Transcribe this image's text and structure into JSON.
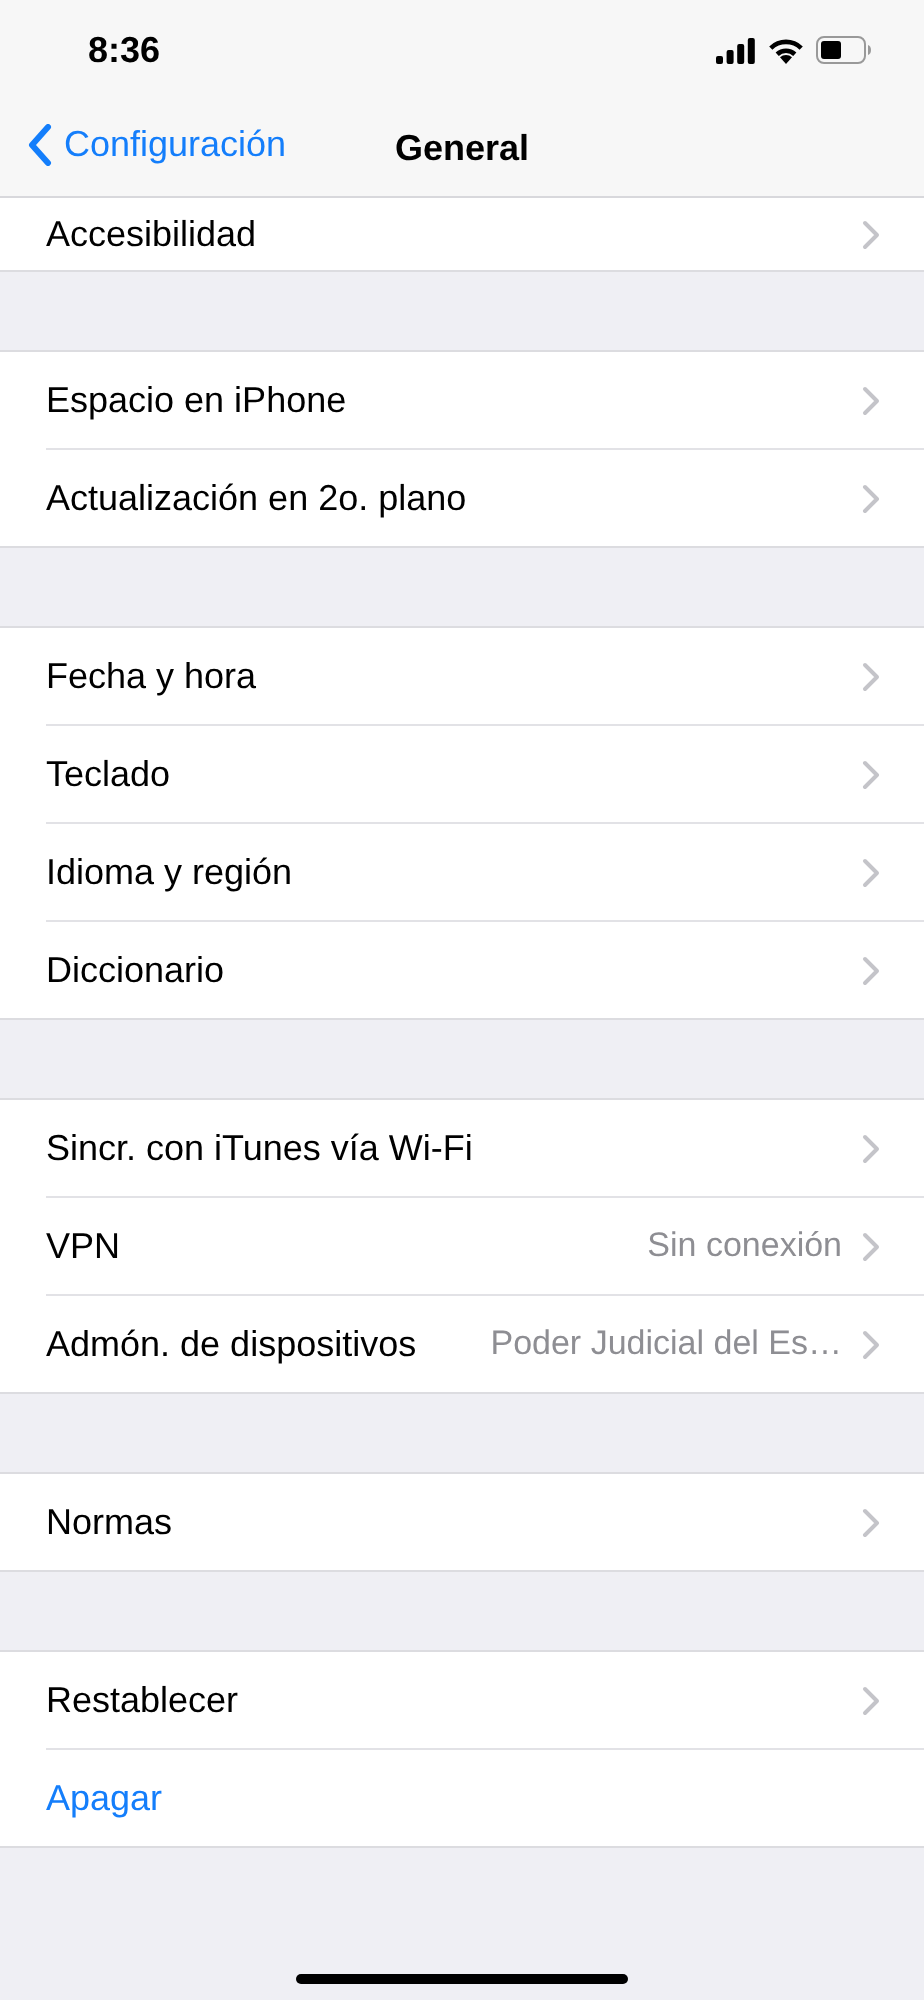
{
  "status_bar": {
    "time": "8:36"
  },
  "nav": {
    "back": "Configuración",
    "title": "General"
  },
  "groups": [
    {
      "clipped_top": true,
      "rows": [
        {
          "kind": "link",
          "label": "Accesibilidad"
        }
      ]
    },
    {
      "rows": [
        {
          "kind": "link",
          "label": "Espacio en iPhone"
        },
        {
          "kind": "link",
          "label": "Actualización en 2o. plano"
        }
      ]
    },
    {
      "rows": [
        {
          "kind": "link",
          "label": "Fecha y hora"
        },
        {
          "kind": "link",
          "label": "Teclado"
        },
        {
          "kind": "link",
          "label": "Idioma y región"
        },
        {
          "kind": "link",
          "label": "Diccionario"
        }
      ]
    },
    {
      "rows": [
        {
          "kind": "link",
          "label": "Sincr. con iTunes vía Wi-Fi"
        },
        {
          "kind": "link",
          "label": "VPN",
          "value": "Sin conexión"
        },
        {
          "kind": "link",
          "label": "Admón. de dispositivos",
          "value": "Poder Judicial del Es…"
        }
      ]
    },
    {
      "rows": [
        {
          "kind": "link",
          "label": "Normas"
        }
      ]
    },
    {
      "rows": [
        {
          "kind": "link",
          "label": "Restablecer"
        },
        {
          "kind": "action",
          "label": "Apagar"
        }
      ]
    }
  ]
}
